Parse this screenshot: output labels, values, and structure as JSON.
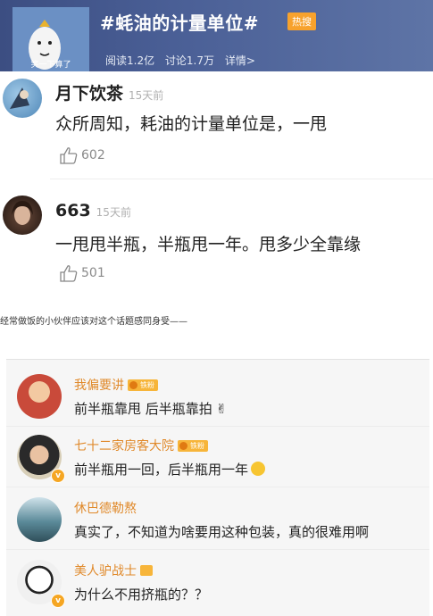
{
  "topic": {
    "thumb_text": "笑一下算了",
    "title": "#蚝油的计量单位#",
    "hot_badge": "热搜",
    "reads": "阅读1.2亿",
    "discussions": "讨论1.7万",
    "details_link": "详情>"
  },
  "top_comments": [
    {
      "username": "月下饮茶",
      "time": "15天前",
      "text": "众所周知，耗油的计量单位是，一甩",
      "likes": "602"
    },
    {
      "username": "663",
      "time": "15天前",
      "text": "一甩甩半瓶，半瓶甩一年。甩多少全靠缘",
      "likes": "501"
    }
  ],
  "caption": "经常做饭的小伙伴应该对这个话题感同身受——",
  "card_comments": [
    {
      "username": "我偏要讲",
      "badge": "铁粉",
      "text": "前半瓶靠甩 后半瓶靠拍"
    },
    {
      "username": "七十二家房客大院",
      "badge": "铁粉",
      "text": "前半瓶用一回，后半瓶用一年"
    },
    {
      "username": "休巴德勒熬",
      "badge": "",
      "text": "真实了，不知道为啥要用这种包装，真的很难用啊"
    },
    {
      "username": "美人驴战士",
      "badge": "",
      "text": "为什么不用挤瓶的？？"
    }
  ],
  "colors": {
    "header_bg": "#4a5f96",
    "hot_badge": "#f7a22d",
    "card_username": "#e0892a",
    "card_bg": "#f6f6f6"
  }
}
